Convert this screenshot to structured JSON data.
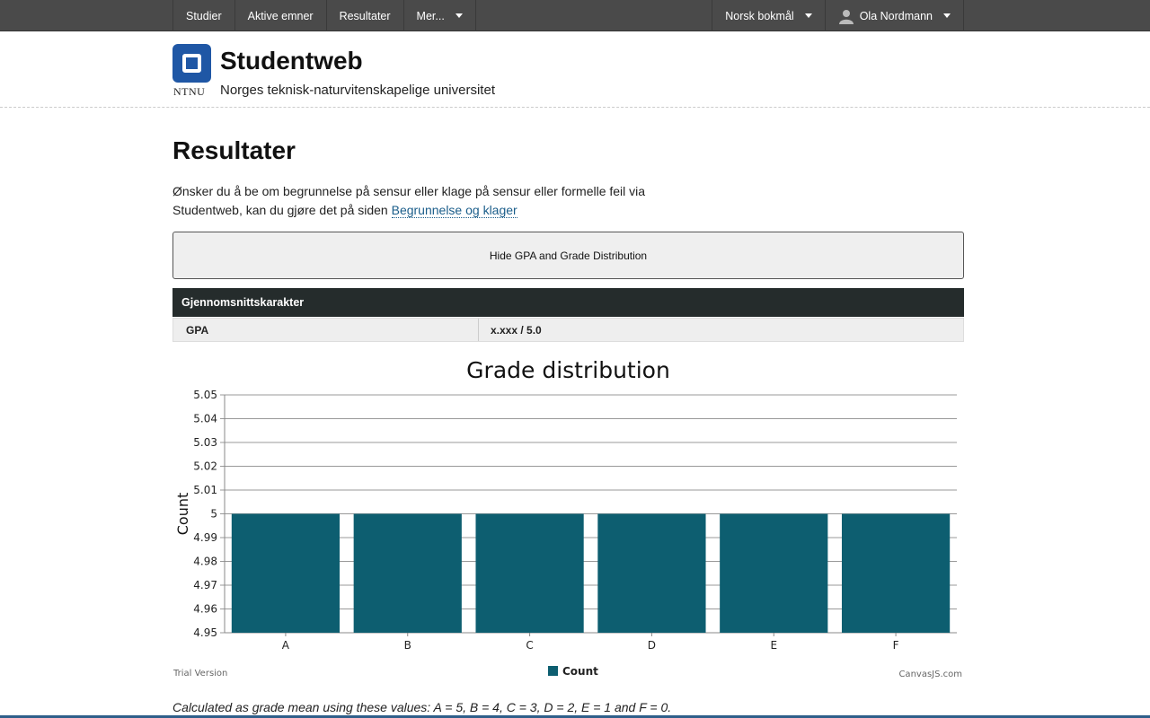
{
  "topnav": {
    "left_items": [
      {
        "label": "Studier",
        "dropdown": false
      },
      {
        "label": "Aktive emner",
        "dropdown": false
      },
      {
        "label": "Resultater",
        "dropdown": false
      },
      {
        "label": "Mer...",
        "dropdown": true
      }
    ],
    "language": "Norsk bokmål",
    "user": "Ola Nordmann"
  },
  "header": {
    "logo_text": "NTNU",
    "title": "Studentweb",
    "subtitle": "Norges teknisk-naturvitenskapelige universitet"
  },
  "main": {
    "title": "Resultater",
    "intro_line1": "Ønsker du å be om begrunnelse på sensur eller klage på sensur eller formelle feil via",
    "intro_line2": "Studentweb, kan du gjøre det på siden ",
    "intro_link": "Begrunnelse og klager",
    "toggle_button": "Hide GPA and Grade Distribution",
    "gpa_table": {
      "header": "Gjennomsnittskarakter",
      "label": "GPA",
      "value": "x.xxx / 5.0"
    },
    "footnote": "Calculated as grade mean using these values: A = 5, B = 4, C = 3, D = 2, E = 1 and F = 0."
  },
  "chart_data": {
    "type": "bar",
    "title": "Grade distribution",
    "xlabel": "",
    "ylabel": "Count",
    "categories": [
      "A",
      "B",
      "C",
      "D",
      "E",
      "F"
    ],
    "series": [
      {
        "name": "Count",
        "values": [
          5,
          5,
          5,
          5,
          5,
          5
        ],
        "color": "#0d5e70"
      }
    ],
    "ylim": [
      4.95,
      5.05
    ],
    "yticks": [
      "4.95",
      "4.96",
      "4.97",
      "4.98",
      "4.99",
      "5",
      "5.01",
      "5.02",
      "5.03",
      "5.04",
      "5.05"
    ],
    "grid": true,
    "legend": "bottom-center",
    "watermark_left": "Trial Version",
    "watermark_right": "CanvasJS.com"
  }
}
